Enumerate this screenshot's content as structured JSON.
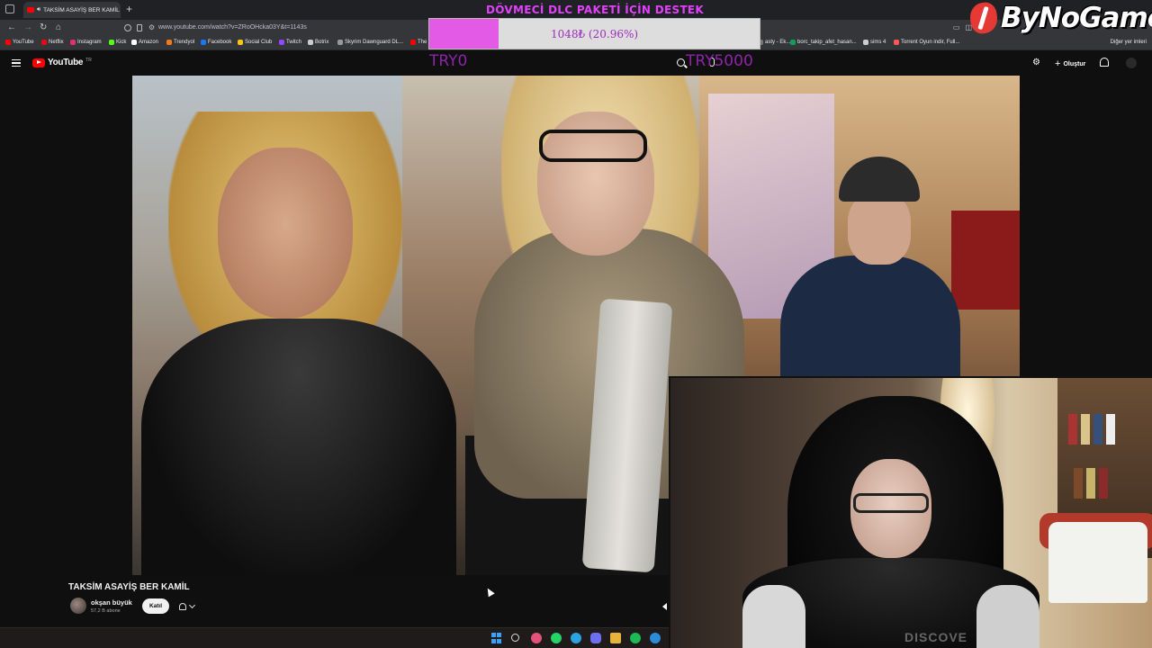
{
  "browser": {
    "tab_title": "TAKSİM ASAYİŞ BER KAMİL",
    "new_tab_label": "+",
    "url": "www.youtube.com/watch?v=ZRoOHcka03Y&t=1143s",
    "bookmarks": [
      {
        "label": "YouTube",
        "color": "#ff0000"
      },
      {
        "label": "Netflix",
        "color": "#e50914"
      },
      {
        "label": "Instagram",
        "color": "#e1306c"
      },
      {
        "label": "Kick",
        "color": "#53fc18"
      },
      {
        "label": "Amazon",
        "color": "#ffffff"
      },
      {
        "label": "Trendyol",
        "color": "#f27a1a"
      },
      {
        "label": "Facebook",
        "color": "#1877f2"
      },
      {
        "label": "Social Club",
        "color": "#f5c518"
      },
      {
        "label": "Twitch",
        "color": "#9146ff"
      },
      {
        "label": "Botrix",
        "color": "#cccccc"
      },
      {
        "label": "Skyrim Dawnguard DL...",
        "color": "#999999"
      },
      {
        "label": "The E",
        "color": "#ff0000"
      },
      {
        "label": "asty - Ek...",
        "color": "#777777"
      },
      {
        "label": "borc_takip_afet_hasan...",
        "color": "#0f9d58"
      },
      {
        "label": "sims 4",
        "color": "#cccccc"
      },
      {
        "label": "Torrent Oyun indir, Full...",
        "color": "#ff5555"
      }
    ],
    "other_bookmarks": "Diğer yer imleri"
  },
  "youtube": {
    "logo_text": "YouTube",
    "logo_country": "TR",
    "create_label": "Oluştur"
  },
  "donation": {
    "title": "DÖVMECİ DLC PAKETİ İÇİN DESTEK",
    "progress_text": "1048₺ (20.96%)",
    "progress_fraction": 0.2096,
    "min_label": "TRY0",
    "max_label": "TRY5000",
    "fill_color": "#e25ae6"
  },
  "brand": {
    "name": "ByNoGame"
  },
  "video": {
    "title": "TAKSİM ASAYİŞ BER KAMİL",
    "channel_name": "okşan büyük",
    "subscribers": "57,2 B abone",
    "join_label": "Katıl"
  },
  "webcam": {
    "shirt_text": "DISCOVE"
  },
  "icons": {
    "tab_list": "tab-list-icon",
    "back": "back-arrow-icon",
    "forward": "forward-arrow-icon",
    "reload": "reload-icon",
    "home": "home-icon",
    "menu": "hamburger-menu-icon",
    "search": "search-icon",
    "mic": "microphone-icon",
    "bell": "bell-icon"
  }
}
